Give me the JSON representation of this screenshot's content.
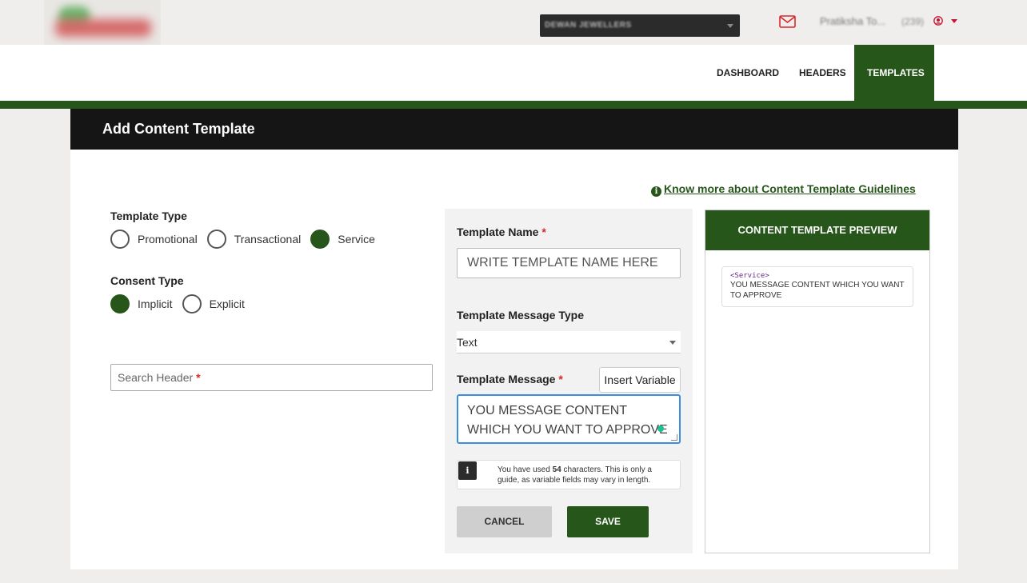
{
  "header": {
    "company_name": "DEWAN JEWELLERS",
    "user_name": "Pratiksha To...",
    "user_count": "(239)",
    "icons": {
      "mail": "mail-icon",
      "user": "user-circle-icon"
    }
  },
  "nav": {
    "items": [
      {
        "label": "DASHBOARD"
      },
      {
        "label": "HEADERS"
      },
      {
        "label": "TEMPLATES",
        "active": true
      }
    ]
  },
  "page": {
    "title": "Add Content Template",
    "guidelines_link": "Know more about Content Template Guidelines"
  },
  "form": {
    "template_type": {
      "label": "Template Type",
      "options": [
        "Promotional",
        "Transactional",
        "Service"
      ],
      "selected": "Service"
    },
    "consent_type": {
      "label": "Consent Type",
      "options": [
        "Implicit",
        "Explicit"
      ],
      "selected": "Implicit"
    },
    "search_header": {
      "placeholder": "Search Header",
      "required_mark": "*"
    },
    "template_name": {
      "label": "Template Name",
      "required_mark": "*",
      "placeholder": "WRITE TEMPLATE NAME HERE"
    },
    "message_type": {
      "label": "Template Message Type",
      "value": "Text"
    },
    "message": {
      "label": "Template Message",
      "required_mark": "*",
      "insert_variable": "Insert Variable",
      "value": "YOU MESSAGE CONTENT WHICH YOU WANT TO APPROVE"
    },
    "char_note": {
      "prefix": "You have used ",
      "count": "54",
      "suffix": " characters. This is only a guide, as variable fields may vary in length."
    },
    "cancel_label": "CANCEL",
    "save_label": "SAVE"
  },
  "preview": {
    "title": "CONTENT TEMPLATE PREVIEW",
    "tag": "<Service>",
    "message": "YOU MESSAGE CONTENT WHICH YOU WANT TO APPROVE"
  },
  "colors": {
    "brand_green": "#26561a",
    "dark_header": "#151515",
    "required": "#d9262c",
    "focus_blue": "#3b8de0"
  }
}
